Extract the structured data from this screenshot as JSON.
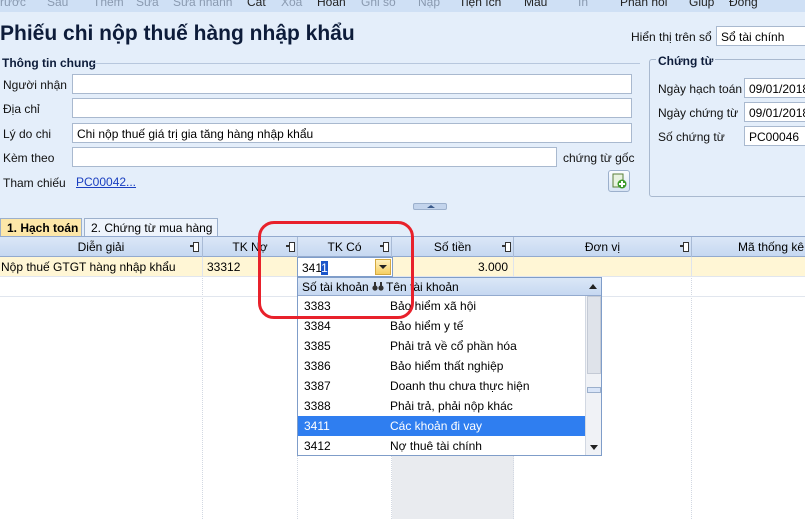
{
  "toolbar": {
    "items": [
      "rước",
      "Sau",
      "Thêm",
      "Sửa",
      "Sửa nhanh",
      "Cất",
      "Xóa",
      "Hoãn",
      "Ghi sổ",
      "Nạp",
      "Tiện ích",
      "Mẫu",
      "In",
      "Phản hồi",
      "Giúp",
      "Đóng"
    ]
  },
  "form": {
    "title": "Phiếu chi nộp thuế hàng nhập khẩu",
    "display_label": "Hiển thị trên sổ",
    "display_value": "Sổ tài chính",
    "general_section": "Thông tin chung",
    "recipient_label": "Người nhận",
    "recipient_value": "",
    "address_label": "Địa chỉ",
    "address_value": "",
    "reason_label": "Lý do chi",
    "reason_value": "Chi nộp thuế giá trị gia tăng hàng nhập khẩu",
    "attach_label": "Kèm theo",
    "attach_value": "",
    "attach_suffix": "chứng từ gốc",
    "reference_label": "Tham chiếu",
    "reference_value": "PC00042",
    "reference_more": "...",
    "voucher_section": "Chứng từ",
    "posting_date_label": "Ngày hạch toán",
    "posting_date_value": "09/01/2018",
    "voucher_date_label": "Ngày chứng từ",
    "voucher_date_value": "09/01/2018",
    "voucher_no_label": "Số chứng từ",
    "voucher_no_value": "PC00046"
  },
  "tabs": [
    {
      "label": "1. Hạch toán",
      "active": true
    },
    {
      "label": "2. Chứng từ mua hàng",
      "active": false
    }
  ],
  "grid": {
    "columns": [
      "Diễn giải",
      "TK Nợ",
      "TK Có",
      "Số tiền",
      "Đơn vị",
      "Mã thống kê"
    ],
    "rows": [
      {
        "description": "Nộp thuế GTGT hàng nhập khẩu",
        "debit": "33312",
        "credit": "3411",
        "amount": "3.000",
        "unit": "",
        "stat_code": ""
      }
    ]
  },
  "combo": {
    "typed": "341",
    "selected_char": "1"
  },
  "dropdown": {
    "col_account": "Số tài khoản",
    "col_name": "Tên tài khoản",
    "items": [
      {
        "code": "3383",
        "name": "Bảo hiểm xã hội"
      },
      {
        "code": "3384",
        "name": "Bảo hiểm y tế"
      },
      {
        "code": "3385",
        "name": "Phải trả về cổ phần hóa"
      },
      {
        "code": "3386",
        "name": "Bảo hiểm thất nghiệp"
      },
      {
        "code": "3387",
        "name": "Doanh thu chưa thực hiện"
      },
      {
        "code": "3388",
        "name": "Phải trả, phải nộp khác"
      },
      {
        "code": "3411",
        "name": "Các khoản đi vay",
        "selected": true
      },
      {
        "code": "3412",
        "name": "Nợ thuê tài chính"
      }
    ]
  },
  "colors": {
    "form_bg": "#e4eefa",
    "active_tab": "#fde7a8",
    "selected_row": "#2f7ef0",
    "annotation": "#e8212b"
  }
}
